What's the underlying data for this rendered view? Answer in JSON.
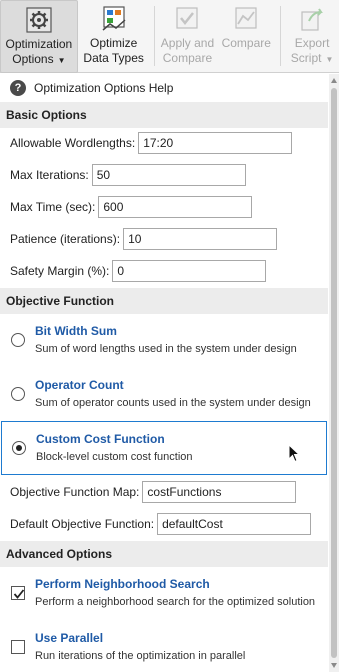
{
  "toolstrip": {
    "optimization_options": {
      "line1": "Optimization",
      "line2": "Options",
      "icon": "gear-settings-icon"
    },
    "optimize_data_types": {
      "line1": "Optimize",
      "line2": "Data Types",
      "icon": "optimize-icon"
    },
    "apply_and_compare": {
      "line1": "Apply and",
      "line2": "Compare",
      "icon": "apply-compare-icon"
    },
    "compare": {
      "line1": "",
      "line2": "Compare",
      "icon": "compare-icon"
    },
    "export_script": {
      "line1": "Export",
      "line2": "Script",
      "icon": "export-icon"
    }
  },
  "help": {
    "label": "Optimization Options Help"
  },
  "basic": {
    "title": "Basic Options",
    "allowable_wordlengths": {
      "label": "Allowable Wordlengths:",
      "value": "17:20"
    },
    "max_iterations": {
      "label": "Max Iterations:",
      "value": "50"
    },
    "max_time": {
      "label": "Max Time (sec):",
      "value": "600"
    },
    "patience": {
      "label": "Patience (iterations):",
      "value": "10"
    },
    "safety_margin": {
      "label": "Safety Margin (%):",
      "value": "0"
    }
  },
  "objective": {
    "title": "Objective Function",
    "options": [
      {
        "title": "Bit Width Sum",
        "desc": "Sum of word lengths used in the system under design",
        "selected": false
      },
      {
        "title": "Operator Count",
        "desc": "Sum of operator counts used in the system under design",
        "selected": false
      },
      {
        "title": "Custom Cost Function",
        "desc": "Block-level custom cost function",
        "selected": true
      }
    ],
    "function_map": {
      "label": "Objective Function Map:",
      "value": "costFunctions"
    },
    "default_function": {
      "label": "Default Objective Function:",
      "value": "defaultCost"
    }
  },
  "advanced": {
    "title": "Advanced Options",
    "neighborhood": {
      "title": "Perform Neighborhood Search",
      "desc": "Perform a neighborhood search for the optimized solution",
      "checked": true
    },
    "parallel": {
      "title": "Use Parallel",
      "desc": "Run iterations of the optimization in parallel",
      "checked": false
    }
  }
}
